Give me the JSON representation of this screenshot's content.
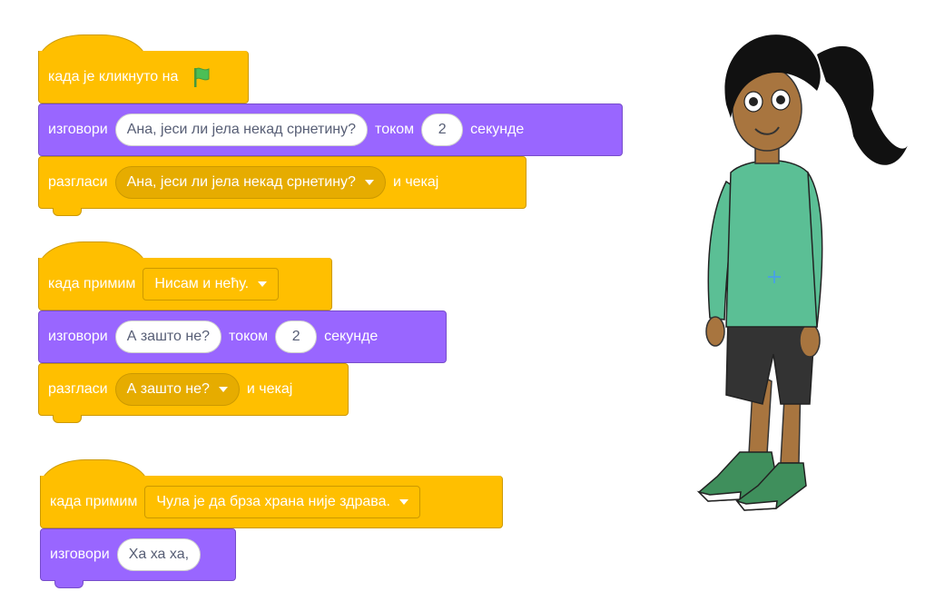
{
  "scripts": [
    {
      "hat": {
        "label": "када је кликнуто на",
        "icon": "green-flag-icon"
      },
      "say": {
        "label": "изговори",
        "text": "Ана, јеси ли јела некад срнетину?",
        "for_label": "током",
        "secs": "2",
        "secs_label": "секунде"
      },
      "broadcast": {
        "label": "разгласи",
        "message": "Ана, јеси ли јела некад срнетину?",
        "wait_label": "и чекај"
      }
    },
    {
      "hat": {
        "label": "када примим",
        "message": "Нисам и нећу."
      },
      "say": {
        "label": "изговори",
        "text": "А зашто не?",
        "for_label": "током",
        "secs": "2",
        "secs_label": "секунде"
      },
      "broadcast": {
        "label": "разгласи",
        "message": "А зашто не?",
        "wait_label": "и чекај"
      }
    },
    {
      "hat": {
        "label": "када примим",
        "message": "Чула је да брза храна није здрава."
      },
      "say": {
        "label": "изговори",
        "text": "Ха ха ха,"
      }
    }
  ],
  "colors": {
    "events": "#ffbf00",
    "looks": "#9966ff",
    "flag": "#4cbf56"
  }
}
